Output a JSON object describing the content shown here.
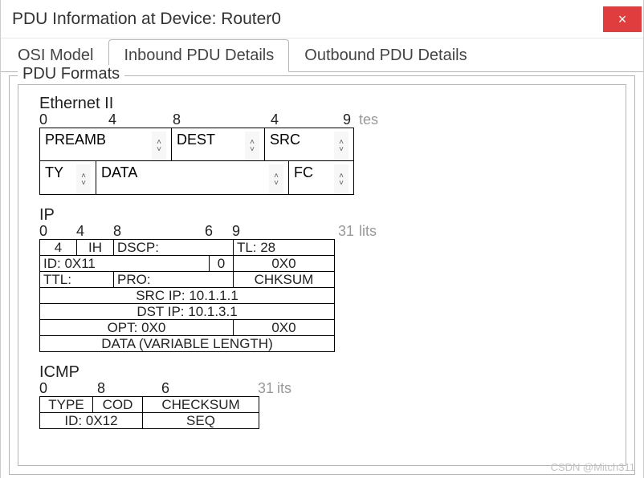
{
  "window": {
    "title": "PDU Information at Device: Router0",
    "close_glyph": "×"
  },
  "tabs": {
    "osi": "OSI Model",
    "inbound": "Inbound PDU Details",
    "outbound": "Outbound PDU Details"
  },
  "fieldset": {
    "legend": "PDU Formats"
  },
  "ethernet": {
    "title": "Ethernet II",
    "rule": {
      "c0": "0",
      "c4": "4",
      "c8": "8",
      "c14": "4",
      "c19": "9",
      "tail": "tes"
    },
    "preamb": "PREAMB",
    "dest": "DEST",
    "src": "SRC",
    "ty": "TY",
    "data": "DATA",
    "fc": "FC"
  },
  "ip": {
    "title": "IP",
    "rule": {
      "c0": "0",
      "c4": "4",
      "c8": "8",
      "c16": "6",
      "c19": "9",
      "tail": "lits",
      "bits": "31"
    },
    "r1": {
      "ver": "4",
      "ihl": "IH",
      "dscp": "DSCP:",
      "tl": "TL: 28"
    },
    "r2": {
      "id": "ID: 0X11",
      "flags": "0",
      "frag": "0X0"
    },
    "r3": {
      "ttl": "TTL:",
      "pro": "PRO:",
      "chk": "CHKSUM"
    },
    "r4": "SRC IP: 10.1.1.1",
    "r5": "DST IP: 10.1.3.1",
    "r6": {
      "opt": "OPT: 0X0",
      "pad": "0X0"
    },
    "r7": "DATA (VARIABLE LENGTH)"
  },
  "icmp": {
    "title": "ICMP",
    "rule": {
      "c0": "0",
      "c8": "8",
      "c16": "6",
      "tail": "its",
      "bits": "31"
    },
    "r1": {
      "type": "TYPE",
      "code": "COD",
      "chk": "CHECKSUM"
    },
    "r2": {
      "id": "ID: 0X12",
      "seq": "SEQ"
    }
  },
  "watermark": "CSDN @Mitch311"
}
